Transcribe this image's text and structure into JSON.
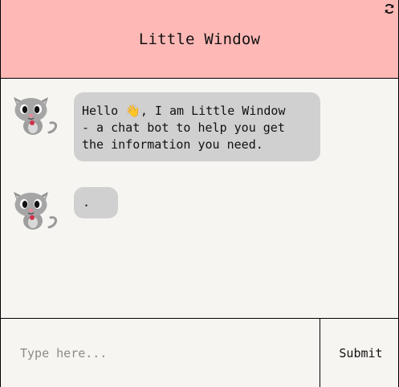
{
  "header": {
    "title": "Little Window",
    "refresh_icon": "refresh-icon"
  },
  "messages": [
    {
      "sender": "bot",
      "avatar_icon": "cat-avatar-icon",
      "text": "Hello 👋, I am Little Window\n- a chat bot to help you get\nthe information you need."
    },
    {
      "sender": "bot",
      "avatar_icon": "cat-avatar-icon",
      "text": "."
    }
  ],
  "composer": {
    "placeholder": "Type here...",
    "value": "",
    "submit_label": "Submit"
  },
  "colors": {
    "header_bg": "#feb8b6",
    "page_bg": "#f7f5f1",
    "bubble_bg": "#d0d0d0"
  }
}
